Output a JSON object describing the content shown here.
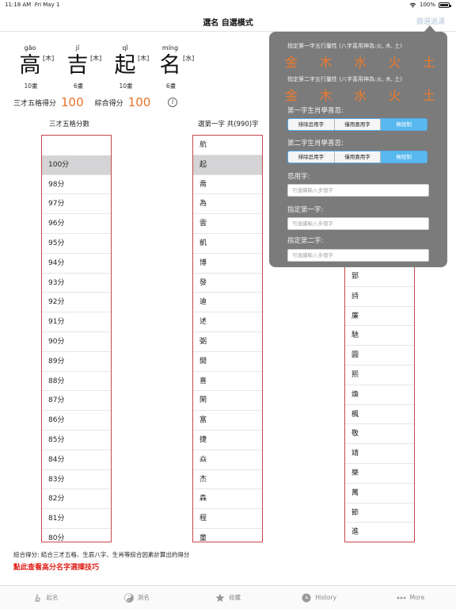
{
  "status": {
    "time": "11:18 AM",
    "date": "Fri May 1",
    "battery": "100%"
  },
  "nav": {
    "title": "選名 自選模式",
    "filter_button": "篩選過濾"
  },
  "name_chars": [
    {
      "pinyin": "gāo",
      "char": "高",
      "element": "[木]",
      "strokes": "10畫"
    },
    {
      "pinyin": "jí",
      "char": "吉",
      "element": "[木]",
      "strokes": "6畫"
    },
    {
      "pinyin": "qǐ",
      "char": "起",
      "element": "[木]",
      "strokes": "10畫"
    },
    {
      "pinyin": "míng",
      "char": "名",
      "element": "[水]",
      "strokes": "6畫"
    }
  ],
  "scores": {
    "sancai_label": "三才五格得分",
    "sancai_value": "100",
    "overall_label": "綜合得分",
    "overall_value": "100",
    "info_icon": "i"
  },
  "columns": {
    "score_header": "三才五格分數",
    "first_header": "選第一字 共(990)字"
  },
  "score_list": [
    "",
    "100分",
    "98分",
    "97分",
    "96分",
    "95分",
    "94分",
    "93分",
    "92分",
    "91分",
    "90分",
    "89分",
    "88分",
    "87分",
    "86分",
    "85分",
    "84分",
    "83分",
    "82分",
    "81分",
    "80分"
  ],
  "first_char_list": [
    "航",
    "起",
    "喬",
    "為",
    "雲",
    "凱",
    "博",
    "發",
    "迪",
    "述",
    "弼",
    "開",
    "喜",
    "閑",
    "富",
    "捷",
    "焱",
    "杰",
    "森",
    "程",
    "童"
  ],
  "second_char_list": [
    "郅",
    "詩",
    "廉",
    "馳",
    "圓",
    "熙",
    "煥",
    "楓",
    "敬",
    "靖",
    "樂",
    "萬",
    "節",
    "進"
  ],
  "footer": {
    "note": "綜合得分: 結合三才五格、生辰八字、生肖等綜合因素計算出的得分",
    "link": "點此查看高分名字選擇技巧"
  },
  "popover": {
    "first_wuxing_label": "指定第一字五行屬性 (八字喜用神為:火, 木, 土)",
    "first_wuxing": [
      "金",
      "木",
      "水",
      "火",
      "土"
    ],
    "second_wuxing_label": "指定第二字五行屬性 (八字喜用神為:火, 木, 土)",
    "second_wuxing": [
      "金",
      "木",
      "水",
      "火",
      "土"
    ],
    "first_zodiac_label": "第一字生肖學喜忌:",
    "first_zodiac_options": [
      "排除忌用字",
      "僅用喜用字",
      "無限制"
    ],
    "second_zodiac_label": "第二字生肖學喜忌:",
    "second_zodiac_options": [
      "排除忌用字",
      "僅用喜用字",
      "無限制"
    ],
    "avoid_label": "忌用字:",
    "avoid_placeholder": "可連續輸入多個字",
    "first_char_label": "指定第一字:",
    "first_char_placeholder": "可連續輸入多個字",
    "second_char_label": "指定第二字:",
    "second_char_placeholder": "可連續輸入多個字"
  },
  "tabs": [
    {
      "icon": "naming-icon",
      "label": "起名"
    },
    {
      "icon": "yin-yang-icon",
      "label": "測名"
    },
    {
      "icon": "star-icon",
      "label": "收藏"
    },
    {
      "icon": "history-icon",
      "label": "History"
    },
    {
      "icon": "more-icon",
      "label": "More"
    }
  ]
}
